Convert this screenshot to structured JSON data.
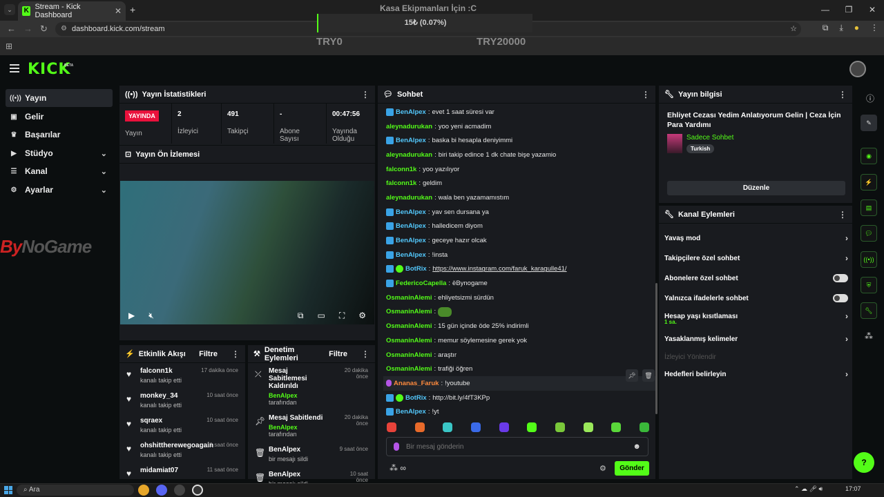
{
  "browser": {
    "tab_title": "Stream - Kick Dashboard",
    "url": "dashboard.kick.com/stream"
  },
  "overlay": {
    "title": "Kasa Ekipmanları İçin :C",
    "progress_text": "15₺ (0.07%)",
    "progress_fraction": 0.0007,
    "left_label": "TRY0",
    "right_label": "TRY20000"
  },
  "brand": {
    "logo": "KICK",
    "beta": "BETA"
  },
  "nav": [
    {
      "label": "Yayın",
      "icon": "broadcast-icon",
      "active": true
    },
    {
      "label": "Gelir",
      "icon": "money-icon"
    },
    {
      "label": "Başarılar",
      "icon": "trophy-icon"
    },
    {
      "label": "Stüdyo",
      "icon": "studio-icon",
      "expandable": true
    },
    {
      "label": "Kanal",
      "icon": "channel-icon",
      "expandable": true
    },
    {
      "label": "Ayarlar",
      "icon": "gear-icon",
      "expandable": true
    }
  ],
  "sponsor": {
    "prefix": "By",
    "name": "NoGame"
  },
  "stats": {
    "header": "Yayın İstatistikleri",
    "live_badge": "YAYINDA",
    "live_label": "Yayın",
    "viewers_value": "2",
    "viewers_label": "İzleyici",
    "followers_value": "491",
    "followers_label": "Takipçi",
    "subs_value": "-",
    "subs_label": "Abone Sayısı",
    "uptime_value": "00:47:56",
    "uptime_label": "Yayında Olduğu"
  },
  "preview": {
    "header": "Yayın Ön İzlemesi"
  },
  "activity": {
    "header": "Etkinlik Akışı",
    "filter": "Filtre",
    "items": [
      {
        "name": "falconn1k",
        "sub": "kanalı takip etti",
        "time": "17 dakika önce"
      },
      {
        "name": "monkey_34",
        "sub": "kanalı takip etti",
        "time": "10 saat önce"
      },
      {
        "name": "sqraex",
        "sub": "kanalı takip etti",
        "time": "10 saat önce"
      },
      {
        "name": "ohshittherewegoagain",
        "sub": "kanalı takip etti",
        "time": "11 saat önce"
      },
      {
        "name": "midamiat07",
        "sub": "",
        "time": "11 saat önce"
      }
    ]
  },
  "mod": {
    "header": "Denetim Eylemleri",
    "filter": "Filtre",
    "items": [
      {
        "title": "Mesaj Sabitlemesi Kaldırıldı",
        "by": "BenAlpex",
        "by_suffix": "tarafından",
        "time": "20 dakika önce"
      },
      {
        "title": "Mesaj Sabitlendi",
        "by": "BenAlpex",
        "by_suffix": "tarafından",
        "time": "20 dakika önce"
      },
      {
        "title": "BenAlpex",
        "sub": "bir mesajı sildi",
        "time": "9 saat önce"
      },
      {
        "title": "BenAlpex",
        "sub": "bir mesajı sildi",
        "time": "10 saat önce"
      }
    ]
  },
  "chat": {
    "header": "Sohbet",
    "messages": [
      {
        "user": "BenAlpex",
        "text": "evet 1 saat süresi var",
        "badge": "mod",
        "color": "b"
      },
      {
        "user": "aleynadurukan",
        "text": "yoo yeni acmadim"
      },
      {
        "user": "BenAlpex",
        "text": "baska bi hesapla deniyimmi",
        "badge": "mod",
        "color": "b"
      },
      {
        "user": "aleynadurukan",
        "text": "biri takip edince 1 dk chate bişe yazamio"
      },
      {
        "user": "falconn1k",
        "text": "yoo yazılıyor"
      },
      {
        "user": "falconn1k",
        "text": "geldim"
      },
      {
        "user": "aleynadurukan",
        "text": "wala ben yazamamıstım"
      },
      {
        "user": "BenAlpex",
        "text": "yav sen dursana ya",
        "badge": "mod",
        "color": "b"
      },
      {
        "user": "BenAlpex",
        "text": "halledicem diyom",
        "badge": "mod",
        "color": "b"
      },
      {
        "user": "BenAlpex",
        "text": "geceye hazır olcak",
        "badge": "mod",
        "color": "b"
      },
      {
        "user": "BenAlpex",
        "text": "!insta",
        "badge": "mod",
        "color": "b"
      },
      {
        "user": "BotRix",
        "text": "https://www.instagram.com/faruk_karagulle41/",
        "badge": "bot",
        "color": "b",
        "link": true
      },
      {
        "user": "FedericoCapella",
        "text": "ëBynogame",
        "badge": "mod"
      },
      {
        "user": "OsmaninAlemi",
        "text": "ehliyetsizmi sürdün"
      },
      {
        "user": "OsmaninAlemi",
        "text": "",
        "emote": true
      },
      {
        "user": "OsmaninAlemi",
        "text": "15 gün içinde öde 25% indirimli"
      },
      {
        "user": "OsmaninAlemi",
        "text": "memur söylemesine gerek yok"
      },
      {
        "user": "OsmaninAlemi",
        "text": "araştır"
      },
      {
        "user": "OsmaninAlemi",
        "text": "trafiği öğren"
      },
      {
        "user": "Ananas_Faruk",
        "text": "!youtube",
        "badge": "mic",
        "color": "o",
        "highlight": true
      },
      {
        "user": "BotRix",
        "text": "http://bit.ly/4fT3KPp",
        "badge": "bot",
        "color": "b"
      },
      {
        "user": "BenAlpex",
        "text": "!yt",
        "badge": "mod",
        "color": "b"
      }
    ],
    "input_placeholder": "Bir mesaj gönderin",
    "send_label": "Gönder",
    "footer_icons": "∞"
  },
  "info": {
    "header": "Yayın bilgisi",
    "title": "Ehliyet Cezası Yedim Anlatıyorum Gelin | Ceza İçin Para Yardımı",
    "category": "Sadece Sohbet",
    "language": "Turkish",
    "edit_label": "Düzenle"
  },
  "actions": {
    "header": "Kanal Eylemleri",
    "rows": [
      {
        "label": "Yavaş mod",
        "type": "chevron"
      },
      {
        "label": "Takipçilere özel sohbet",
        "type": "chevron"
      },
      {
        "label": "Abonelere özel sohbet",
        "type": "toggle"
      },
      {
        "label": "Yalnızca ifadelerle sohbet",
        "type": "toggle"
      },
      {
        "label": "Hesap yaşı kısıtlaması",
        "type": "chevron",
        "sub": "1 sa."
      },
      {
        "label": "Yasaklanmış kelimeler",
        "type": "chevron"
      },
      {
        "label": "İzleyici Yönlendir",
        "type": "disabled"
      },
      {
        "label": "Hedefleri belirleyin",
        "type": "chevron"
      }
    ]
  },
  "taskbar": {
    "search": "Ara",
    "clock": "17:07"
  },
  "colors": {
    "accent": "#53fc18",
    "live": "#e9113c",
    "panel": "#191b1f",
    "bg": "#0b0e0f"
  }
}
